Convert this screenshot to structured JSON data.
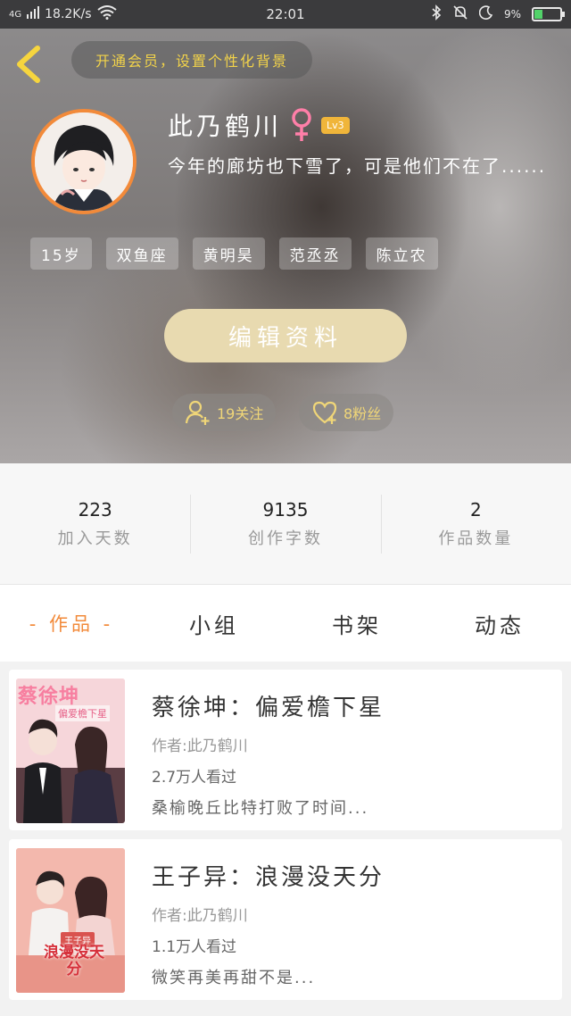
{
  "status_bar": {
    "network": "4G",
    "speed": "18.2K/s",
    "time": "22:01",
    "battery_percent": "9%",
    "battery_level": 0.09
  },
  "header": {
    "vip_banner": "开通会员，设置个性化背景"
  },
  "profile": {
    "name": "此乃鹤川",
    "level": "Lv3",
    "signature": "今年的廊坊也下雪了，可是他们不在了......",
    "tags": [
      "15岁",
      "双鱼座",
      "黄明昊",
      "范丞丞",
      "陈立农"
    ],
    "edit_label": "编辑资料",
    "follow_label": "19关注",
    "fans_label": "8粉丝"
  },
  "stats": [
    {
      "value": "223",
      "label": "加入天数"
    },
    {
      "value": "9135",
      "label": "创作字数"
    },
    {
      "value": "2",
      "label": "作品数量"
    }
  ],
  "tabs": [
    {
      "label": "- 作品 -",
      "active": true
    },
    {
      "label": "小组",
      "active": false
    },
    {
      "label": "书架",
      "active": false
    },
    {
      "label": "动态",
      "active": false
    }
  ],
  "works": [
    {
      "title": "蔡徐坤：偏爱檐下星",
      "author": "作者:此乃鹤川",
      "views": "2.7万人看过",
      "desc": "桑榆晚丘比特打败了时间...",
      "cover_text_main": "蔡徐坤",
      "cover_text_sub": "偏爱檐下星"
    },
    {
      "title": "王子异：浪漫没天分",
      "author": "作者:此乃鹤川",
      "views": "1.1万人看过",
      "desc": "微笑再美再甜不是...",
      "cover_text_top": "王子异",
      "cover_text_main": "浪漫没天分"
    }
  ],
  "colors": {
    "accent": "#f28a3a",
    "vip_text": "#f2d34a",
    "edit_button": "#e8dab0",
    "gender_female": "#ff7fa8"
  },
  "icons": [
    "back-arrow-icon",
    "add-user-icon",
    "heart-icon",
    "female-icon",
    "bluetooth-icon",
    "bell-off-icon",
    "moon-icon",
    "wifi-icon",
    "battery-icon"
  ]
}
